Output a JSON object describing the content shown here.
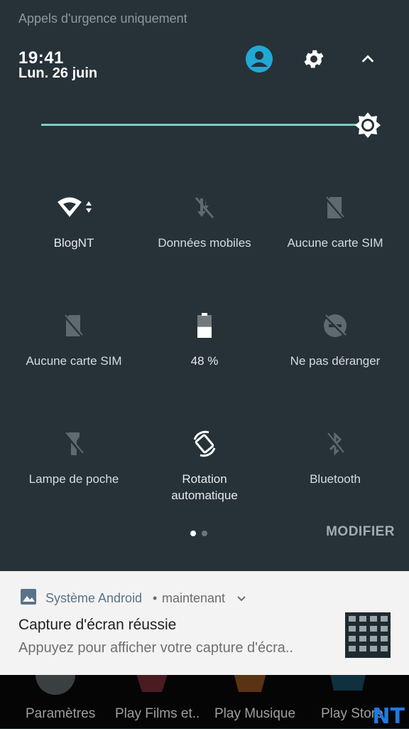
{
  "status": {
    "text": "Appels d'urgence uniquement"
  },
  "header": {
    "time": "19:41",
    "date": "Lun. 26 juin"
  },
  "brightness": {
    "level_percent": 100
  },
  "tiles": [
    {
      "label": "BlogNT",
      "icon": "wifi-icon",
      "active": true
    },
    {
      "label": "Données mobiles",
      "icon": "mobile-data-off-icon",
      "active": false
    },
    {
      "label": "Aucune carte SIM",
      "icon": "no-sim-icon",
      "active": false
    },
    {
      "label": "Aucune carte SIM",
      "icon": "no-sim-icon",
      "active": false
    },
    {
      "label": "48 %",
      "icon": "battery-icon",
      "active": true
    },
    {
      "label": "Ne pas déranger",
      "icon": "do-not-disturb-off-icon",
      "active": false
    },
    {
      "label": "Lampe de poche",
      "icon": "flashlight-off-icon",
      "active": false
    },
    {
      "label": "Rotation\nautomatique",
      "icon": "auto-rotate-icon",
      "active": true
    },
    {
      "label": "Bluetooth",
      "icon": "bluetooth-off-icon",
      "active": false
    }
  ],
  "pager": {
    "page": 1,
    "total": 2
  },
  "modifier_label": "MODIFIER",
  "notification": {
    "app": "Système Android",
    "separator": "•",
    "time": "maintenant",
    "title": "Capture d'écran réussie",
    "text": "Appuyez pour afficher votre capture d'écra.."
  },
  "home": {
    "apps": [
      "Paramètres",
      "Play Films et..",
      "Play Musique",
      "Play Store"
    ],
    "watermark": "NT"
  },
  "colors": {
    "panel": "#263238",
    "accent": "#80cbc4",
    "user": "#1fa9d6",
    "notification_bg": "#f3f3f3"
  }
}
